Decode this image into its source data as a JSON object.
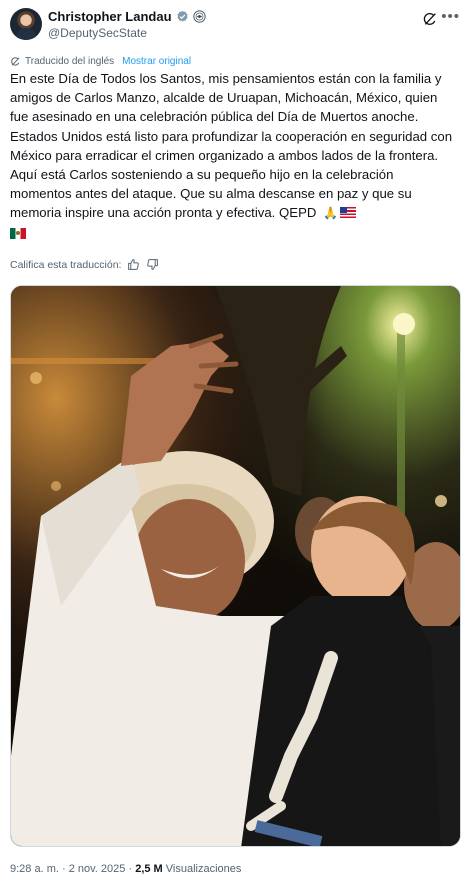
{
  "author": {
    "name": "Christopher Landau",
    "handle": "@DeputySecState"
  },
  "translation": {
    "note": "Traducido del inglés",
    "show_original": "Mostrar original",
    "rate_prompt": "Califica esta traducción:"
  },
  "tweet": {
    "text": "En este Día de Todos los Santos, mis pensamientos están con la familia y amigos de Carlos Manzo, alcalde de Uruapan, Michoacán, México, quien fue asesinado en una celebración pública del Día de Muertos anoche. Estados Unidos está listo para profundizar la cooperación en seguridad con México para erradicar el crimen organizado a ambos lados de la frontera. Aquí está Carlos sosteniendo a su pequeño hijo en la celebración momentos antes del ataque. Que su alma descanse en paz y que su memoria inspire una acción pronta y efectiva. QEPD"
  },
  "footer": {
    "time": "9:28 a. m.",
    "separator": "·",
    "date": "2 nov. 2025",
    "views_count": "2,5 M",
    "views_label": "Visualizaciones"
  },
  "icons": {
    "verified": "verified-badge-icon",
    "affiliate": "government-seal-icon",
    "grok": "grok-icon",
    "more": "more-icon",
    "translate": "translate-icon",
    "thumb_up": "thumb-up-icon",
    "thumb_down": "thumb-down-icon"
  },
  "colors": {
    "link": "#1d9bf0",
    "secondary_text": "#536471"
  }
}
